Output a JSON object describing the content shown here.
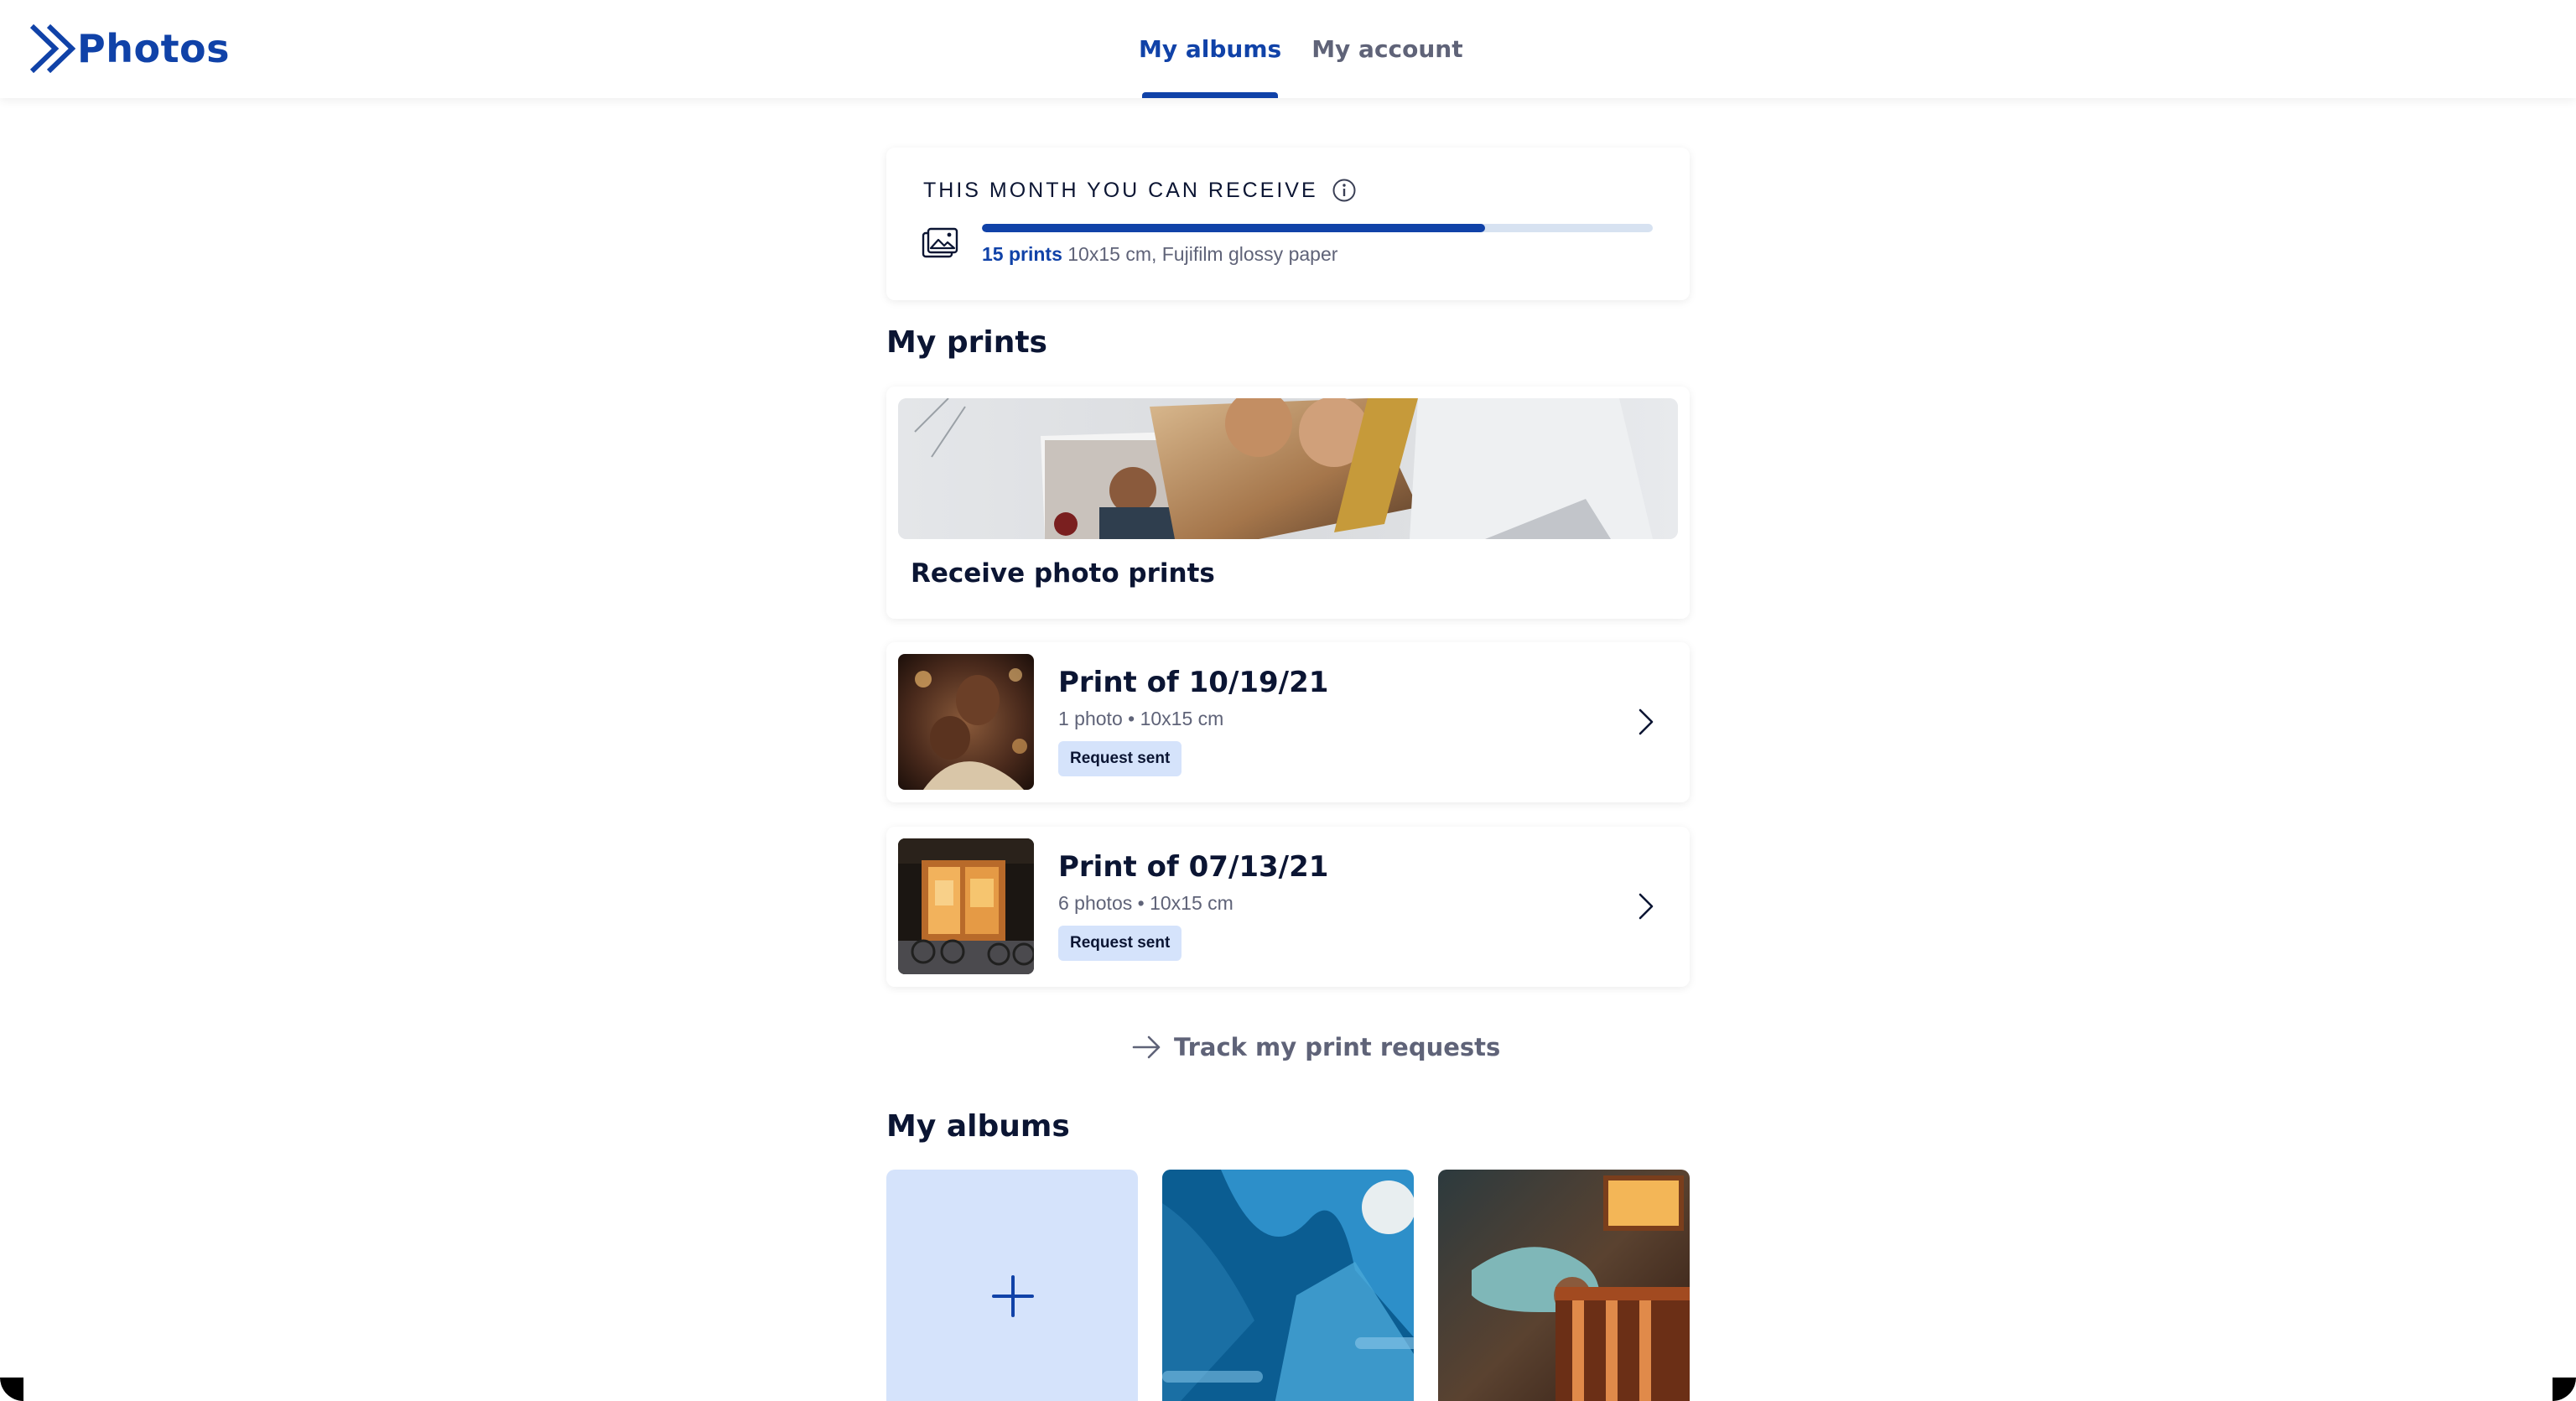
{
  "app": {
    "name": "Photos",
    "brand_color": "#1042a8"
  },
  "nav": {
    "tabs": [
      {
        "label": "My albums",
        "active": true
      },
      {
        "label": "My account",
        "active": false
      }
    ]
  },
  "quota": {
    "title": "THIS MONTH YOU CAN RECEIVE",
    "info_icon": "info-icon",
    "prints_icon": "prints-icon",
    "progress_fraction": 0.75,
    "count_label": "15 prints",
    "details": "10x15 cm, Fujifilm glossy paper"
  },
  "prints_section": {
    "title": "My prints",
    "receive_label": "Receive photo prints",
    "items": [
      {
        "title": "Print of 10/19/21",
        "meta": "1 photo • 10x15 cm",
        "status": "Request sent"
      },
      {
        "title": "Print of 07/13/21",
        "meta": "6 photos • 10x15 cm",
        "status": "Request sent"
      }
    ]
  },
  "track_link": {
    "label": "Track my print requests",
    "icon": "arrow-right-icon"
  },
  "albums_section": {
    "title": "My albums",
    "add_icon": "plus-icon"
  }
}
